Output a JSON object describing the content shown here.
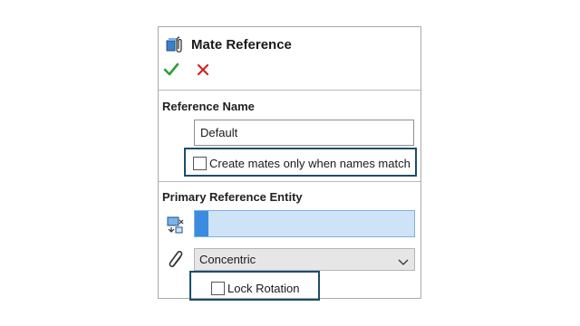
{
  "panel": {
    "title": "Mate Reference",
    "actions": {
      "ok_icon": "checkmark-icon",
      "cancel_icon": "x-icon"
    }
  },
  "reference_name": {
    "section_title": "Reference Name",
    "value": "Default",
    "checkbox_label": "Create mates only when names match",
    "checkbox_checked": false
  },
  "primary_entity": {
    "section_title": "Primary Reference Entity",
    "selection_value": "",
    "mate_type": "Concentric",
    "lock_label": "Lock Rotation",
    "lock_checked": false
  },
  "colors": {
    "accept": "#2e9e3a",
    "cancel": "#d1261f",
    "highlight_border": "#1b4e6b",
    "selection_fill": "#cfe3f7",
    "selection_bar": "#3b8be0"
  }
}
